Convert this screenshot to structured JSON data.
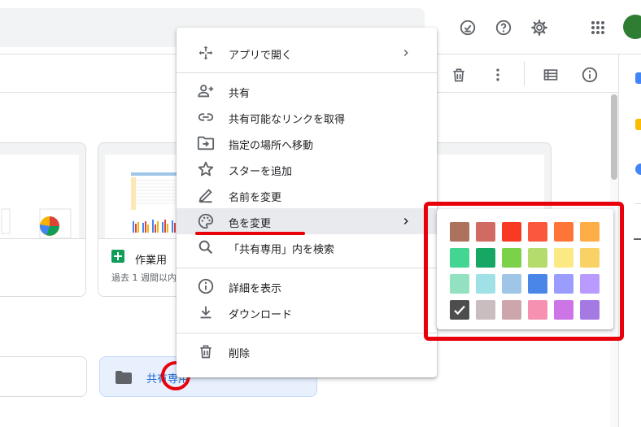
{
  "header": {
    "avatar_initial": "",
    "icons": [
      "task-check-icon",
      "help-icon",
      "settings-gear-icon",
      "apps-grid-icon"
    ]
  },
  "toolbar": {
    "icons": [
      "trash-icon",
      "more-vert-icon",
      "list-view-icon",
      "info-icon"
    ]
  },
  "files": [
    {
      "title": "",
      "subtitle": ""
    },
    {
      "title": "作業用",
      "subtitle": "過去 1 週間以内"
    }
  ],
  "folders": [
    {
      "label": ""
    },
    {
      "label": "共有専用"
    }
  ],
  "context_menu": {
    "items": [
      {
        "label": "アプリで開く",
        "icon": "open-with-icon",
        "has_submenu": true
      },
      {
        "label": "共有",
        "icon": "person-add-icon",
        "has_submenu": false
      },
      {
        "label": "共有可能なリンクを取得",
        "icon": "link-icon",
        "has_submenu": false
      },
      {
        "label": "指定の場所へ移動",
        "icon": "move-to-folder-icon",
        "has_submenu": false
      },
      {
        "label": "スターを追加",
        "icon": "star-icon",
        "has_submenu": false
      },
      {
        "label": "名前を変更",
        "icon": "pencil-icon",
        "has_submenu": false
      },
      {
        "label": "色を変更",
        "icon": "palette-icon",
        "has_submenu": true,
        "active": true
      },
      {
        "label": "「共有専用」内を検索",
        "icon": "search-icon",
        "has_submenu": false
      },
      {
        "label": "詳細を表示",
        "icon": "info-icon",
        "has_submenu": false
      },
      {
        "label": "ダウンロード",
        "icon": "download-icon",
        "has_submenu": false
      },
      {
        "label": "削除",
        "icon": "trash-icon",
        "has_submenu": false
      }
    ]
  },
  "color_palette": {
    "selected": "#4d4d4d",
    "rows": [
      [
        "#ac725e",
        "#d06b64",
        "#f83a22",
        "#fa573c",
        "#ff7537",
        "#ffad46"
      ],
      [
        "#42d692",
        "#16a765",
        "#7bd148",
        "#b3dc6c",
        "#fbe983",
        "#fad165"
      ],
      [
        "#92e1c0",
        "#9fe1e7",
        "#9fc6e7",
        "#4986e7",
        "#9a9cff",
        "#b99aff"
      ],
      [
        "#4d4d4d",
        "#cabdbf",
        "#cca6ac",
        "#f691b2",
        "#cd74e6",
        "#a47ae2"
      ]
    ]
  },
  "colors": {
    "annotation_red": "#e8000b",
    "sheets_green": "#0f9d58",
    "folder_blue": "#1967d2"
  }
}
